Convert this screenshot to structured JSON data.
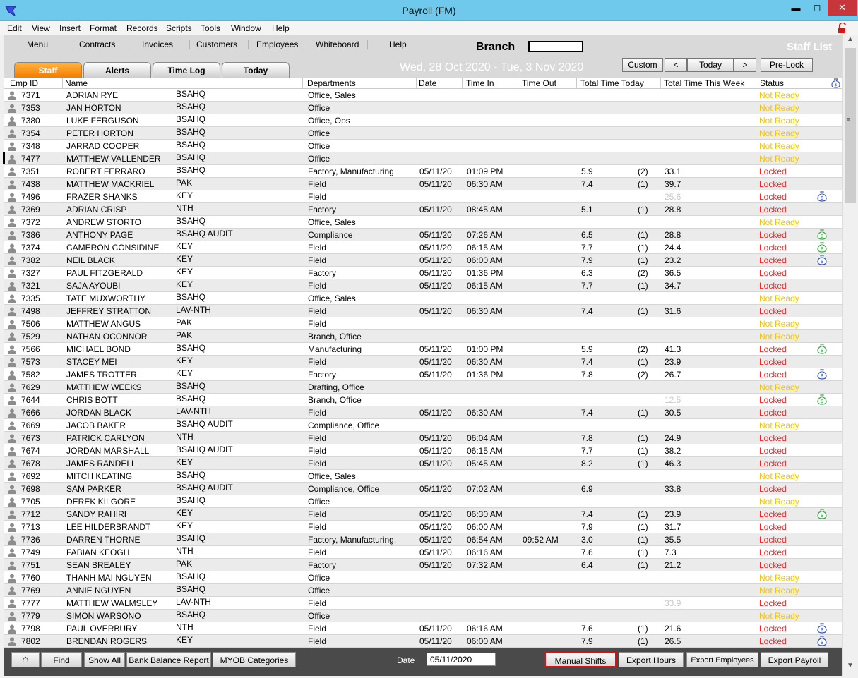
{
  "window": {
    "title": "Payroll (FM)",
    "min": "▬",
    "max": "◻",
    "close": "✕"
  },
  "menu": [
    "Edit",
    "View",
    "Insert",
    "Format",
    "Records",
    "Scripts",
    "Tools",
    "Window",
    "Help"
  ],
  "nav": [
    "Menu",
    "Contracts",
    "Invoices",
    "Customers",
    "Employees",
    "Whiteboard",
    "Help"
  ],
  "header": {
    "branch_label": "Branch",
    "branch_value": "",
    "staff_list": "Staff List",
    "date_range": "Wed, 28 Oct 2020 - Tue, 3 Nov 2020",
    "custom": "Custom",
    "prev": "<",
    "today": "Today",
    "next": ">",
    "prelock": "Pre-Lock"
  },
  "tabs": [
    "Staff",
    "Alerts",
    "Time Log",
    "Today"
  ],
  "columns": [
    "Emp ID",
    "Name",
    "Departments",
    "Date",
    "Time In",
    "Time Out",
    "Total Time Today",
    "Total Time This Week",
    "Status"
  ],
  "colors": {
    "not_ready": "#f5c400",
    "locked": "#ff2020",
    "money_blue": "#3a55b8",
    "money_green": "#3fa34a",
    "active_tab": "#f47c00"
  },
  "rows": [
    {
      "id": "7371",
      "name": "ADRIAN RYE",
      "branch": "BSAHQ",
      "dept": "Office, Sales",
      "date": "",
      "in": "",
      "out": "",
      "tt": "",
      "cnt": "",
      "tw": "",
      "status": "Not Ready",
      "money": ""
    },
    {
      "id": "7353",
      "name": "JAN HORTON",
      "branch": "BSAHQ",
      "dept": "Office",
      "date": "",
      "in": "",
      "out": "",
      "tt": "",
      "cnt": "",
      "tw": "",
      "status": "Not Ready",
      "money": ""
    },
    {
      "id": "7380",
      "name": "LUKE FERGUSON",
      "branch": "BSAHQ",
      "dept": "Office, Ops",
      "date": "",
      "in": "",
      "out": "",
      "tt": "",
      "cnt": "",
      "tw": "",
      "status": "Not Ready",
      "money": ""
    },
    {
      "id": "7354",
      "name": "PETER HORTON",
      "branch": "BSAHQ",
      "dept": "Office",
      "date": "",
      "in": "",
      "out": "",
      "tt": "",
      "cnt": "",
      "tw": "",
      "status": "Not Ready",
      "money": ""
    },
    {
      "id": "7348",
      "name": "JARRAD COOPER",
      "branch": "BSAHQ",
      "dept": "Office",
      "date": "",
      "in": "",
      "out": "",
      "tt": "",
      "cnt": "",
      "tw": "",
      "status": "Not Ready",
      "money": ""
    },
    {
      "id": "7477",
      "name": "MATTHEW VALLENDER",
      "branch": "BSAHQ",
      "dept": "Office",
      "date": "",
      "in": "",
      "out": "",
      "tt": "",
      "cnt": "",
      "tw": "",
      "status": "Not Ready",
      "money": ""
    },
    {
      "id": "7351",
      "name": "ROBERT FERRARO",
      "branch": "BSAHQ",
      "dept": "Factory, Manufacturing",
      "date": "05/11/20",
      "in": "01:09 PM",
      "out": "",
      "tt": "5.9",
      "cnt": "(2)",
      "tw": "33.1",
      "status": "Locked",
      "money": ""
    },
    {
      "id": "7438",
      "name": "MATTHEW MACKRIEL",
      "branch": "PAK",
      "dept": "Field",
      "date": "05/11/20",
      "in": "06:30 AM",
      "out": "",
      "tt": "7.4",
      "cnt": "(1)",
      "tw": "39.7",
      "status": "Locked",
      "money": ""
    },
    {
      "id": "7496",
      "name": "FRAZER SHANKS",
      "branch": "KEY",
      "dept": "Field",
      "date": "",
      "in": "",
      "out": "",
      "tt": "",
      "cnt": "",
      "tw": "25.6",
      "twgrey": true,
      "status": "Locked",
      "money": "blue"
    },
    {
      "id": "7369",
      "name": "ADRIAN CRISP",
      "branch": "NTH",
      "dept": "Factory",
      "date": "05/11/20",
      "in": "08:45 AM",
      "out": "",
      "tt": "5.1",
      "cnt": "(1)",
      "tw": "28.8",
      "status": "Locked",
      "money": ""
    },
    {
      "id": "7372",
      "name": "ANDREW STORTO",
      "branch": "BSAHQ",
      "dept": "Office, Sales",
      "date": "",
      "in": "",
      "out": "",
      "tt": "",
      "cnt": "",
      "tw": "",
      "status": "Not Ready",
      "money": ""
    },
    {
      "id": "7386",
      "name": "ANTHONY PAGE",
      "branch": "BSAHQ AUDIT",
      "dept": "Compliance",
      "date": "05/11/20",
      "in": "07:26 AM",
      "out": "",
      "tt": "6.5",
      "cnt": "(1)",
      "tw": "28.8",
      "status": "Locked",
      "money": "green"
    },
    {
      "id": "7374",
      "name": "CAMERON CONSIDINE",
      "branch": "KEY",
      "dept": "Field",
      "date": "05/11/20",
      "in": "06:15 AM",
      "out": "",
      "tt": "7.7",
      "cnt": "(1)",
      "tw": "24.4",
      "status": "Locked",
      "money": "green"
    },
    {
      "id": "7382",
      "name": "NEIL BLACK",
      "branch": "KEY",
      "dept": "Field",
      "date": "05/11/20",
      "in": "06:00 AM",
      "out": "",
      "tt": "7.9",
      "cnt": "(1)",
      "tw": "23.2",
      "status": "Locked",
      "money": "blue"
    },
    {
      "id": "7327",
      "name": "PAUL FITZGERALD",
      "branch": "KEY",
      "dept": "Factory",
      "date": "05/11/20",
      "in": "01:36 PM",
      "out": "",
      "tt": "6.3",
      "cnt": "(2)",
      "tw": "36.5",
      "status": "Locked",
      "money": ""
    },
    {
      "id": "7321",
      "name": "SAJA AYOUBI",
      "branch": "KEY",
      "dept": "Field",
      "date": "05/11/20",
      "in": "06:15 AM",
      "out": "",
      "tt": "7.7",
      "cnt": "(1)",
      "tw": "34.7",
      "status": "Locked",
      "money": ""
    },
    {
      "id": "7335",
      "name": "TATE MUXWORTHY",
      "branch": "BSAHQ",
      "dept": "Office, Sales",
      "date": "",
      "in": "",
      "out": "",
      "tt": "",
      "cnt": "",
      "tw": "",
      "status": "Not Ready",
      "money": ""
    },
    {
      "id": "7498",
      "name": "JEFFREY STRATTON",
      "branch": "LAV-NTH",
      "dept": "Field",
      "date": "05/11/20",
      "in": "06:30 AM",
      "out": "",
      "tt": "7.4",
      "cnt": "(1)",
      "tw": "31.6",
      "status": "Locked",
      "money": ""
    },
    {
      "id": "7506",
      "name": "MATTHEW ANGUS",
      "branch": "PAK",
      "dept": "Field",
      "date": "",
      "in": "",
      "out": "",
      "tt": "",
      "cnt": "",
      "tw": "",
      "status": "Not Ready",
      "money": ""
    },
    {
      "id": "7529",
      "name": "NATHAN OCONNOR",
      "branch": "PAK",
      "dept": "Branch, Office",
      "date": "",
      "in": "",
      "out": "",
      "tt": "",
      "cnt": "",
      "tw": "",
      "status": "Not Ready",
      "money": ""
    },
    {
      "id": "7566",
      "name": "MICHAEL BOND",
      "branch": "BSAHQ",
      "dept": "Manufacturing",
      "date": "05/11/20",
      "in": "01:00 PM",
      "out": "",
      "tt": "5.9",
      "cnt": "(2)",
      "tw": "41.3",
      "status": "Locked",
      "money": "green"
    },
    {
      "id": "7573",
      "name": "STACEY MEI",
      "branch": "KEY",
      "dept": "Field",
      "date": "05/11/20",
      "in": "06:30 AM",
      "out": "",
      "tt": "7.4",
      "cnt": "(1)",
      "tw": "23.9",
      "status": "Locked",
      "money": ""
    },
    {
      "id": "7582",
      "name": "JAMES TROTTER",
      "branch": "KEY",
      "dept": "Factory",
      "date": "05/11/20",
      "in": "01:36 PM",
      "out": "",
      "tt": "7.8",
      "cnt": "(2)",
      "tw": "26.7",
      "status": "Locked",
      "money": "blue"
    },
    {
      "id": "7629",
      "name": "MATTHEW WEEKS",
      "branch": "BSAHQ",
      "dept": "Drafting, Office",
      "date": "",
      "in": "",
      "out": "",
      "tt": "",
      "cnt": "",
      "tw": "",
      "status": "Not Ready",
      "money": ""
    },
    {
      "id": "7644",
      "name": "CHRIS BOTT",
      "branch": "BSAHQ",
      "dept": "Branch, Office",
      "date": "",
      "in": "",
      "out": "",
      "tt": "",
      "cnt": "",
      "tw": "12.5",
      "twgrey": true,
      "status": "Locked",
      "money": "green"
    },
    {
      "id": "7666",
      "name": "JORDAN BLACK",
      "branch": "LAV-NTH",
      "dept": "Field",
      "date": "05/11/20",
      "in": "06:30 AM",
      "out": "",
      "tt": "7.4",
      "cnt": "(1)",
      "tw": "30.5",
      "status": "Locked",
      "money": ""
    },
    {
      "id": "7669",
      "name": "JACOB BAKER",
      "branch": "BSAHQ AUDIT",
      "dept": "Compliance, Office",
      "date": "",
      "in": "",
      "out": "",
      "tt": "",
      "cnt": "",
      "tw": "",
      "status": "Not Ready",
      "money": ""
    },
    {
      "id": "7673",
      "name": "PATRICK CARLYON",
      "branch": "NTH",
      "dept": "Field",
      "date": "05/11/20",
      "in": "06:04 AM",
      "out": "",
      "tt": "7.8",
      "cnt": "(1)",
      "tw": "24.9",
      "status": "Locked",
      "money": ""
    },
    {
      "id": "7674",
      "name": "JORDAN MARSHALL",
      "branch": "BSAHQ AUDIT",
      "dept": "Field",
      "date": "05/11/20",
      "in": "06:15 AM",
      "out": "",
      "tt": "7.7",
      "cnt": "(1)",
      "tw": "38.2",
      "status": "Locked",
      "money": ""
    },
    {
      "id": "7678",
      "name": "JAMES RANDELL",
      "branch": "KEY",
      "dept": "Field",
      "date": "05/11/20",
      "in": "05:45 AM",
      "out": "",
      "tt": "8.2",
      "cnt": "(1)",
      "tw": "46.3",
      "status": "Locked",
      "money": ""
    },
    {
      "id": "7692",
      "name": "MITCH KEATING",
      "branch": "BSAHQ",
      "dept": "Office, Sales",
      "date": "",
      "in": "",
      "out": "",
      "tt": "",
      "cnt": "",
      "tw": "",
      "status": "Not Ready",
      "money": ""
    },
    {
      "id": "7698",
      "name": "SAM PARKER",
      "branch": "BSAHQ AUDIT",
      "dept": "Compliance, Office",
      "date": "05/11/20",
      "in": "07:02 AM",
      "out": "",
      "tt": "6.9",
      "cnt": "",
      "tw": "33.8",
      "status": "Locked",
      "money": ""
    },
    {
      "id": "7705",
      "name": "DEREK KILGORE",
      "branch": "BSAHQ",
      "dept": "Office",
      "date": "",
      "in": "",
      "out": "",
      "tt": "",
      "cnt": "",
      "tw": "",
      "status": "Not Ready",
      "money": ""
    },
    {
      "id": "7712",
      "name": "SANDY RAHIRI",
      "branch": "KEY",
      "dept": "Field",
      "date": "05/11/20",
      "in": "06:30 AM",
      "out": "",
      "tt": "7.4",
      "cnt": "(1)",
      "tw": "23.9",
      "status": "Locked",
      "money": "green"
    },
    {
      "id": "7713",
      "name": "LEE HILDERBRANDT",
      "branch": "KEY",
      "dept": "Field",
      "date": "05/11/20",
      "in": "06:00 AM",
      "out": "",
      "tt": "7.9",
      "cnt": "(1)",
      "tw": "31.7",
      "status": "Locked",
      "money": ""
    },
    {
      "id": "7736",
      "name": "DARREN THORNE",
      "branch": "BSAHQ",
      "dept": "Factory, Manufacturing,",
      "date": "05/11/20",
      "in": "06:54 AM",
      "out": "09:52 AM",
      "tt": "3.0",
      "cnt": "(1)",
      "tw": "35.5",
      "status": "Locked",
      "money": ""
    },
    {
      "id": "7749",
      "name": "FABIAN KEOGH",
      "branch": "NTH",
      "dept": "Field",
      "date": "05/11/20",
      "in": "06:16 AM",
      "out": "",
      "tt": "7.6",
      "cnt": "(1)",
      "tw": "7.3",
      "status": "Locked",
      "money": ""
    },
    {
      "id": "7751",
      "name": "SEAN BREALEY",
      "branch": "PAK",
      "dept": "Factory",
      "date": "05/11/20",
      "in": "07:32 AM",
      "out": "",
      "tt": "6.4",
      "cnt": "(1)",
      "tw": "21.2",
      "status": "Locked",
      "money": ""
    },
    {
      "id": "7760",
      "name": "THANH MAI NGUYEN",
      "branch": "BSAHQ",
      "dept": "Office",
      "date": "",
      "in": "",
      "out": "",
      "tt": "",
      "cnt": "",
      "tw": "",
      "status": "Not Ready",
      "money": ""
    },
    {
      "id": "7769",
      "name": "ANNIE NGUYEN",
      "branch": "BSAHQ",
      "dept": "Office",
      "date": "",
      "in": "",
      "out": "",
      "tt": "",
      "cnt": "",
      "tw": "",
      "status": "Not Ready",
      "money": ""
    },
    {
      "id": "7777",
      "name": "MATTHEW WALMSLEY",
      "branch": "LAV-NTH",
      "dept": "Field",
      "date": "",
      "in": "",
      "out": "",
      "tt": "",
      "cnt": "",
      "tw": "33.9",
      "twgrey": true,
      "status": "Locked",
      "money": ""
    },
    {
      "id": "7779",
      "name": "SIMON WARSONO",
      "branch": "BSAHQ",
      "dept": "Office",
      "date": "",
      "in": "",
      "out": "",
      "tt": "",
      "cnt": "",
      "tw": "",
      "status": "Not Ready",
      "money": ""
    },
    {
      "id": "7798",
      "name": "PAUL OVERBURY",
      "branch": "NTH",
      "dept": "Field",
      "date": "05/11/20",
      "in": "06:16 AM",
      "out": "",
      "tt": "7.6",
      "cnt": "(1)",
      "tw": "21.6",
      "status": "Locked",
      "money": "blue"
    },
    {
      "id": "7802",
      "name": "BRENDAN ROGERS",
      "branch": "KEY",
      "dept": "Field",
      "date": "05/11/20",
      "in": "06:00 AM",
      "out": "",
      "tt": "7.9",
      "cnt": "(1)",
      "tw": "26.5",
      "status": "Locked",
      "money": "blue"
    }
  ],
  "footer": {
    "home": "⌂",
    "find": "Find",
    "show_all": "Show All",
    "bank_balance": "Bank Balance Report",
    "myob": "MYOB Categories",
    "date_label": "Date",
    "date_value": "05/11/2020",
    "manual_shifts": "Manual Shifts",
    "export_hours": "Export Hours",
    "export_employees": "Export Employees",
    "export_payroll": "Export Payroll"
  }
}
